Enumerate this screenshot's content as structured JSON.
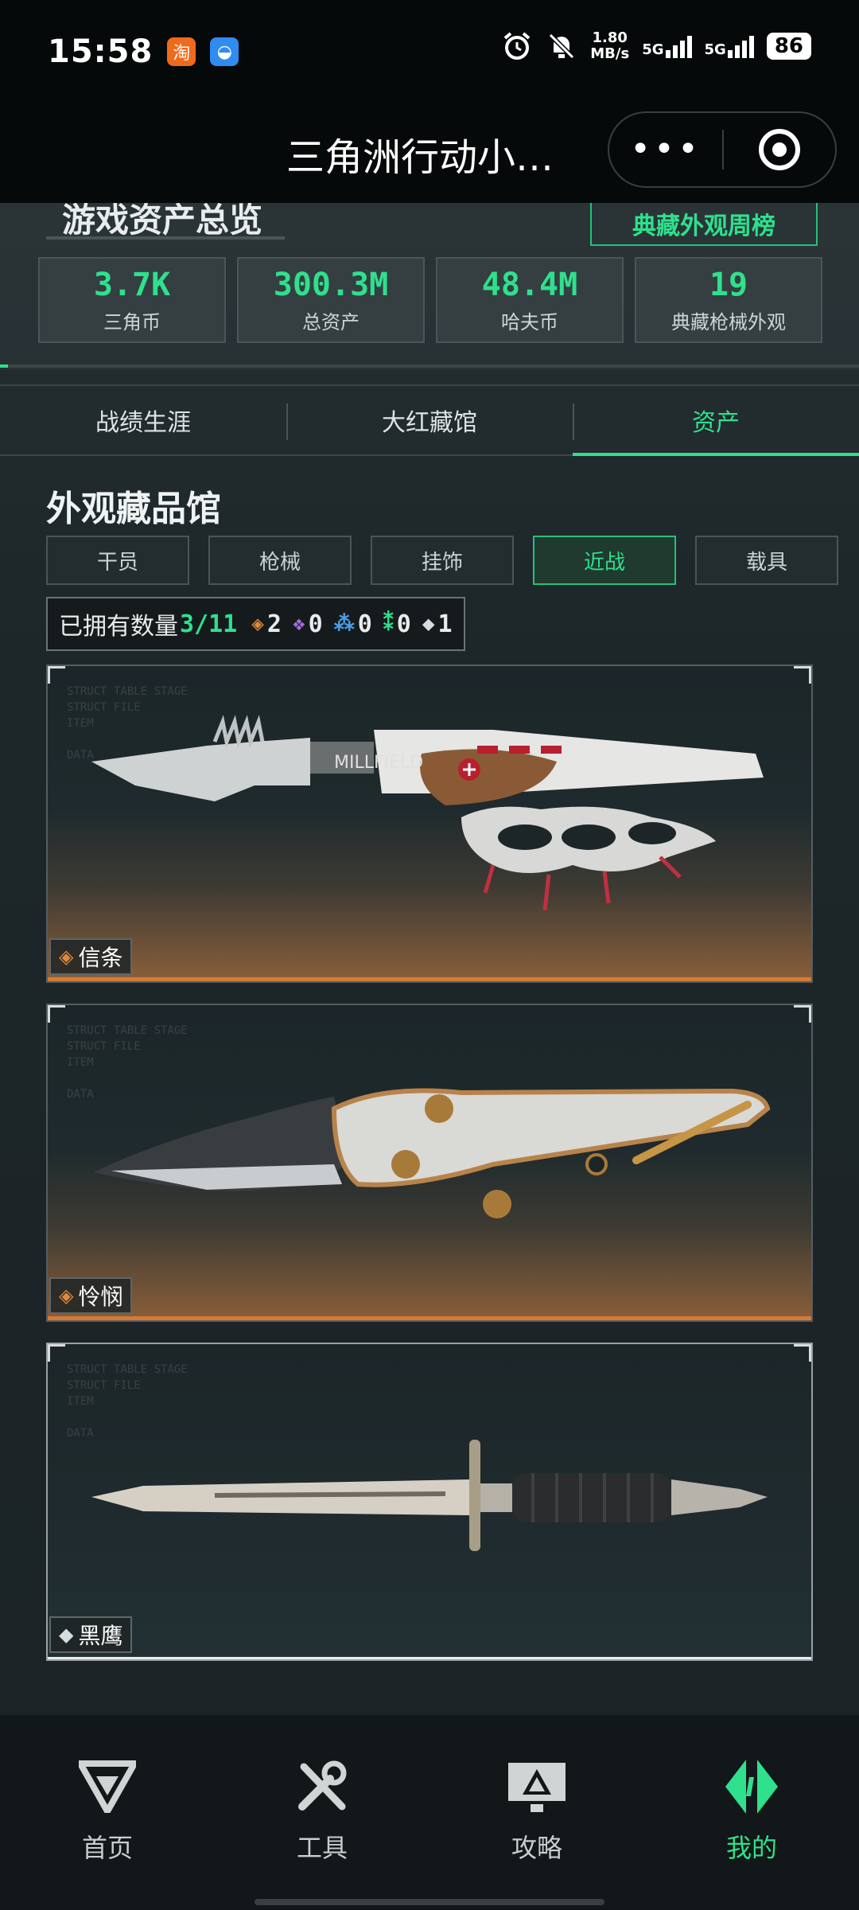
{
  "status_bar": {
    "time": "15:58",
    "speed_value": "1.80",
    "speed_unit": "MB/s",
    "net1": "5G",
    "net2": "5G",
    "battery": "86",
    "app_icons": [
      "taobao-icon",
      "browser-icon"
    ]
  },
  "title_bar": {
    "title": "三角洲行动小…",
    "more": "•••"
  },
  "overview": {
    "title": "游戏资产总览",
    "rank_button": "典藏外观周榜",
    "stats": [
      {
        "value": "3.7K",
        "label": "三角币"
      },
      {
        "value": "300.3M",
        "label": "总资产"
      },
      {
        "value": "48.4M",
        "label": "哈夫币"
      },
      {
        "value": "19",
        "label": "典藏枪械外观"
      }
    ]
  },
  "tabs": [
    {
      "label": "战绩生涯",
      "active": false
    },
    {
      "label": "大红藏馆",
      "active": false
    },
    {
      "label": "资产",
      "active": true
    }
  ],
  "collection": {
    "title": "外观藏品馆",
    "categories": [
      {
        "label": "干员",
        "active": false
      },
      {
        "label": "枪械",
        "active": false
      },
      {
        "label": "挂饰",
        "active": false
      },
      {
        "label": "近战",
        "active": true
      },
      {
        "label": "载具",
        "active": false
      }
    ],
    "owned_label": "已拥有数量",
    "owned_count": "3/11",
    "rarity_counts": [
      {
        "icon": "orange-diamond-icon",
        "color": "#e08a3c",
        "value": "2"
      },
      {
        "icon": "purple-diamond-icon",
        "color": "#a46be0",
        "value": "0"
      },
      {
        "icon": "blue-diamond-icon",
        "color": "#4aa0e8",
        "value": "0"
      },
      {
        "icon": "green-diamond-icon",
        "color": "#2fe08c",
        "value": "0"
      },
      {
        "icon": "white-diamond-icon",
        "color": "#d8dcdc",
        "value": "1"
      }
    ],
    "items": [
      {
        "name": "信条",
        "rarity_color": "#e08a3c",
        "rarity_icon": "orange-diamond-icon"
      },
      {
        "name": "怜悯",
        "rarity_color": "#e08a3c",
        "rarity_icon": "orange-diamond-icon"
      },
      {
        "name": "黑鹰",
        "rarity_color": "#d8dcdc",
        "rarity_icon": "white-diamond-icon"
      }
    ]
  },
  "bottom_nav": [
    {
      "label": "首页",
      "icon": "delta-logo-icon",
      "active": false
    },
    {
      "label": "工具",
      "icon": "tools-icon",
      "active": false
    },
    {
      "label": "攻略",
      "icon": "guide-monitor-icon",
      "active": false
    },
    {
      "label": "我的",
      "icon": "profile-emblem-icon",
      "active": true
    }
  ],
  "colors": {
    "accent": "#2fe08c",
    "background": "#1a2124",
    "legendary": "#e08a3c"
  }
}
